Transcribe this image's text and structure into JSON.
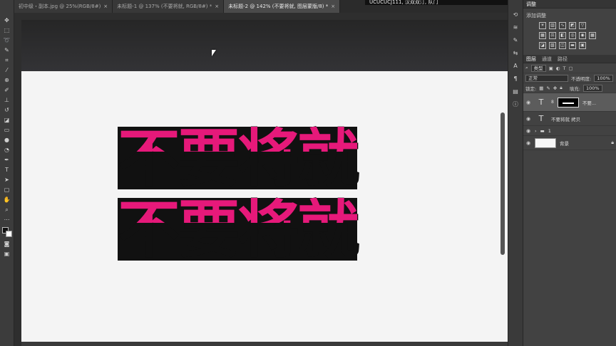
{
  "tabs": [
    {
      "label": "初中级・副本.jpg @ 25%(RGB/8#)",
      "close": "×",
      "active": false
    },
    {
      "label": "未标题-1 @ 137% (不要将就, RGB/8#) *",
      "close": "×",
      "active": false
    },
    {
      "label": "未标题-2 @ 142% (不要将就, 图层蒙版/8) *",
      "close": "×",
      "active": true
    }
  ],
  "overlay_text": "UCUCUCJ111, 汉双双汀, 队门",
  "canvas": {
    "line1": "不要将就",
    "line2": "不要将就",
    "top_color": "#e6197a",
    "bottom_color": "#111111"
  },
  "adjustments": {
    "panel_title": "调整",
    "add_label": "添加调整"
  },
  "layers_panel": {
    "tabs": [
      "图层",
      "通道",
      "路径"
    ],
    "filter_label": "类型",
    "blend_mode": "正常",
    "opacity_label": "不透明度:",
    "opacity_value": "100%",
    "lock_label": "锁定:",
    "fill_label": "填充:",
    "fill_value": "100%",
    "layers": [
      {
        "name": "不要...",
        "kind": "text-with-mask",
        "selected": true
      },
      {
        "name": "不要将就 拷贝",
        "kind": "text",
        "selected": false
      },
      {
        "name": "1",
        "kind": "group",
        "selected": false
      },
      {
        "name": "背景",
        "kind": "background",
        "selected": false
      }
    ]
  },
  "icons": {
    "eye": "eye-icon",
    "lock": "lock-icon",
    "folder": "folder-icon"
  }
}
